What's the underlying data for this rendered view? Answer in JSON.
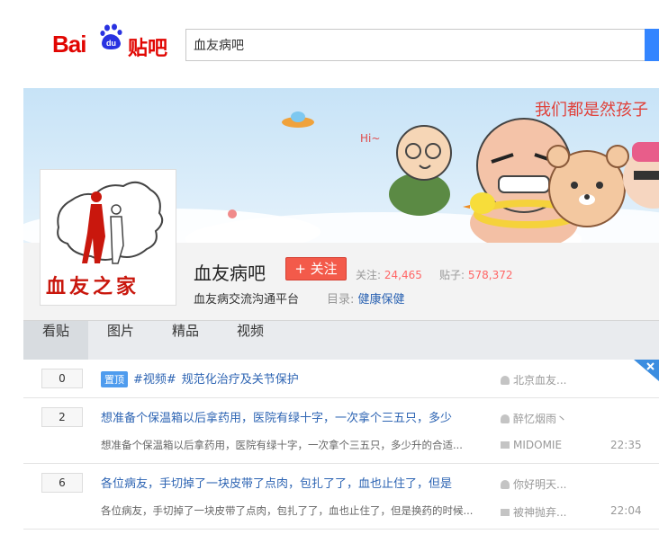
{
  "header": {
    "logo_bai": "Bai",
    "logo_du": "du",
    "logo_tieba": "贴吧",
    "search_value": "血友病吧"
  },
  "banner": {
    "slogan": "我们都是然孩子",
    "hi": "Hi~"
  },
  "forum": {
    "avatar_caption": "血友之家",
    "name": "血友病吧",
    "follow_label": "+ 关注",
    "follow_count_label": "关注:",
    "follow_count": "24,465",
    "post_count_label": "贴子:",
    "post_count": "578,372",
    "slogan": "血友病交流沟通平台",
    "directory_label": "目录:",
    "directory_value": "健康保健"
  },
  "tabs": [
    {
      "label": "看贴"
    },
    {
      "label": "图片"
    },
    {
      "label": "精品"
    },
    {
      "label": "视频"
    }
  ],
  "threads": [
    {
      "replies": "0",
      "badge": "置顶",
      "tag": "#视频#",
      "title": "规范化治疗及关节保护",
      "author": "北京血友...",
      "abstract": "",
      "last_reply": "",
      "time": ""
    },
    {
      "replies": "2",
      "badge": "",
      "tag": "",
      "title": "想准备个保温箱以后拿药用，医院有绿十字，一次拿个三五只，多少",
      "author": "醉忆烟雨丶",
      "abstract": "想准备个保温箱以后拿药用，医院有绿十字，一次拿个三五只，多少升的合适...",
      "last_reply": "MIDOMIE",
      "time": "22:35"
    },
    {
      "replies": "6",
      "badge": "",
      "tag": "",
      "title": "各位病友，手切掉了一块皮带了点肉，包扎了了，血也止住了，但是",
      "author": "你好明天...",
      "abstract": "各位病友，手切掉了一块皮带了点肉，包扎了了，血也止住了，但是换药的时候...",
      "last_reply": "被神抛弃...",
      "time": "22:04"
    }
  ],
  "colors": {
    "brand_red": "#e10602",
    "brand_blue": "#2932e1",
    "link": "#2d64b3",
    "follow": "#f35a4a",
    "count": "#f66"
  }
}
